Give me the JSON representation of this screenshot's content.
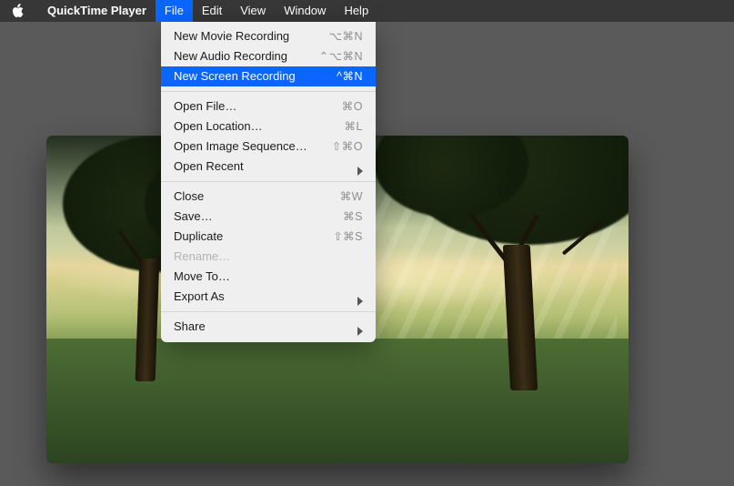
{
  "menubar": {
    "app_name": "QuickTime Player",
    "items": [
      {
        "label": "File",
        "open": true
      },
      {
        "label": "Edit",
        "open": false
      },
      {
        "label": "View",
        "open": false
      },
      {
        "label": "Window",
        "open": false
      },
      {
        "label": "Help",
        "open": false
      }
    ]
  },
  "file_menu": {
    "items": [
      {
        "label": "New Movie Recording",
        "shortcut": "⌥⌘N",
        "has_submenu": false,
        "highlighted": false,
        "enabled": true
      },
      {
        "label": "New Audio Recording",
        "shortcut": "⌃⌥⌘N",
        "has_submenu": false,
        "highlighted": false,
        "enabled": true
      },
      {
        "label": "New Screen Recording",
        "shortcut": "^⌘N",
        "has_submenu": false,
        "highlighted": true,
        "enabled": true
      },
      {
        "separator": true
      },
      {
        "label": "Open File…",
        "shortcut": "⌘O",
        "has_submenu": false,
        "highlighted": false,
        "enabled": true
      },
      {
        "label": "Open Location…",
        "shortcut": "⌘L",
        "has_submenu": false,
        "highlighted": false,
        "enabled": true
      },
      {
        "label": "Open Image Sequence…",
        "shortcut": "⇧⌘O",
        "has_submenu": false,
        "highlighted": false,
        "enabled": true
      },
      {
        "label": "Open Recent",
        "shortcut": "",
        "has_submenu": true,
        "highlighted": false,
        "enabled": true
      },
      {
        "separator": true
      },
      {
        "label": "Close",
        "shortcut": "⌘W",
        "has_submenu": false,
        "highlighted": false,
        "enabled": true
      },
      {
        "label": "Save…",
        "shortcut": "⌘S",
        "has_submenu": false,
        "highlighted": false,
        "enabled": true
      },
      {
        "label": "Duplicate",
        "shortcut": "⇧⌘S",
        "has_submenu": false,
        "highlighted": false,
        "enabled": true
      },
      {
        "label": "Rename…",
        "shortcut": "",
        "has_submenu": false,
        "highlighted": false,
        "enabled": false
      },
      {
        "label": "Move To…",
        "shortcut": "",
        "has_submenu": false,
        "highlighted": false,
        "enabled": true
      },
      {
        "label": "Export As",
        "shortcut": "",
        "has_submenu": true,
        "highlighted": false,
        "enabled": true
      },
      {
        "separator": true
      },
      {
        "label": "Share",
        "shortcut": "",
        "has_submenu": true,
        "highlighted": false,
        "enabled": true
      }
    ]
  },
  "colors": {
    "menu_highlight": "#0a66ff",
    "menu_bg": "#efefef",
    "menubar_bg": "rgba(40,40,40,0.70)"
  }
}
